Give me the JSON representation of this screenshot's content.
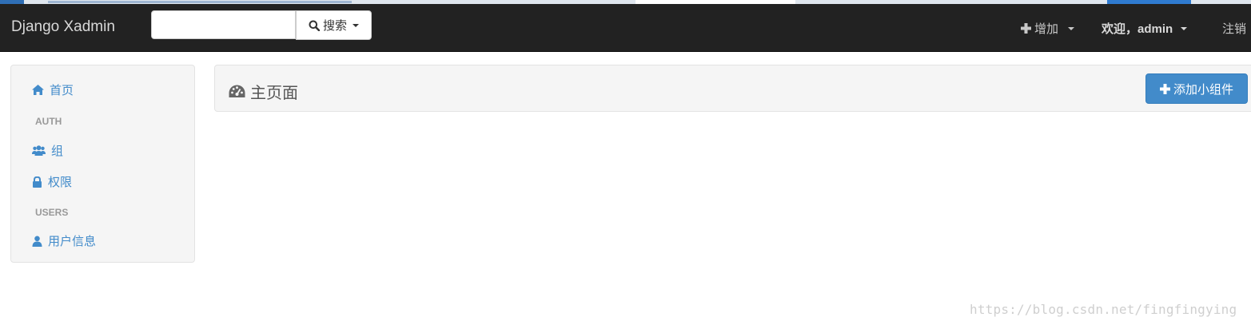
{
  "navbar": {
    "brand": "Django Xadmin",
    "search": {
      "value": "",
      "placeholder": "",
      "button_label": "搜索"
    },
    "add_label": "增加",
    "welcome_label": "欢迎，admin",
    "logout_label": "注销"
  },
  "sidebar": {
    "home": {
      "label": "首页",
      "icon": "home-icon"
    },
    "sections": [
      {
        "header": "AUTH",
        "items": [
          {
            "label": "组",
            "icon": "group-icon"
          },
          {
            "label": "权限",
            "icon": "lock-icon"
          }
        ]
      },
      {
        "header": "USERS",
        "items": [
          {
            "label": "用户信息",
            "icon": "user-icon"
          }
        ]
      }
    ]
  },
  "main": {
    "title": "主页面",
    "title_icon": "dashboard-icon",
    "add_widget_label": "添加小组件"
  },
  "watermark": "https://blog.csdn.net/fingfingying",
  "colors": {
    "navbar_bg": "#222222",
    "link": "#428bca",
    "primary_button": "#428bca"
  }
}
